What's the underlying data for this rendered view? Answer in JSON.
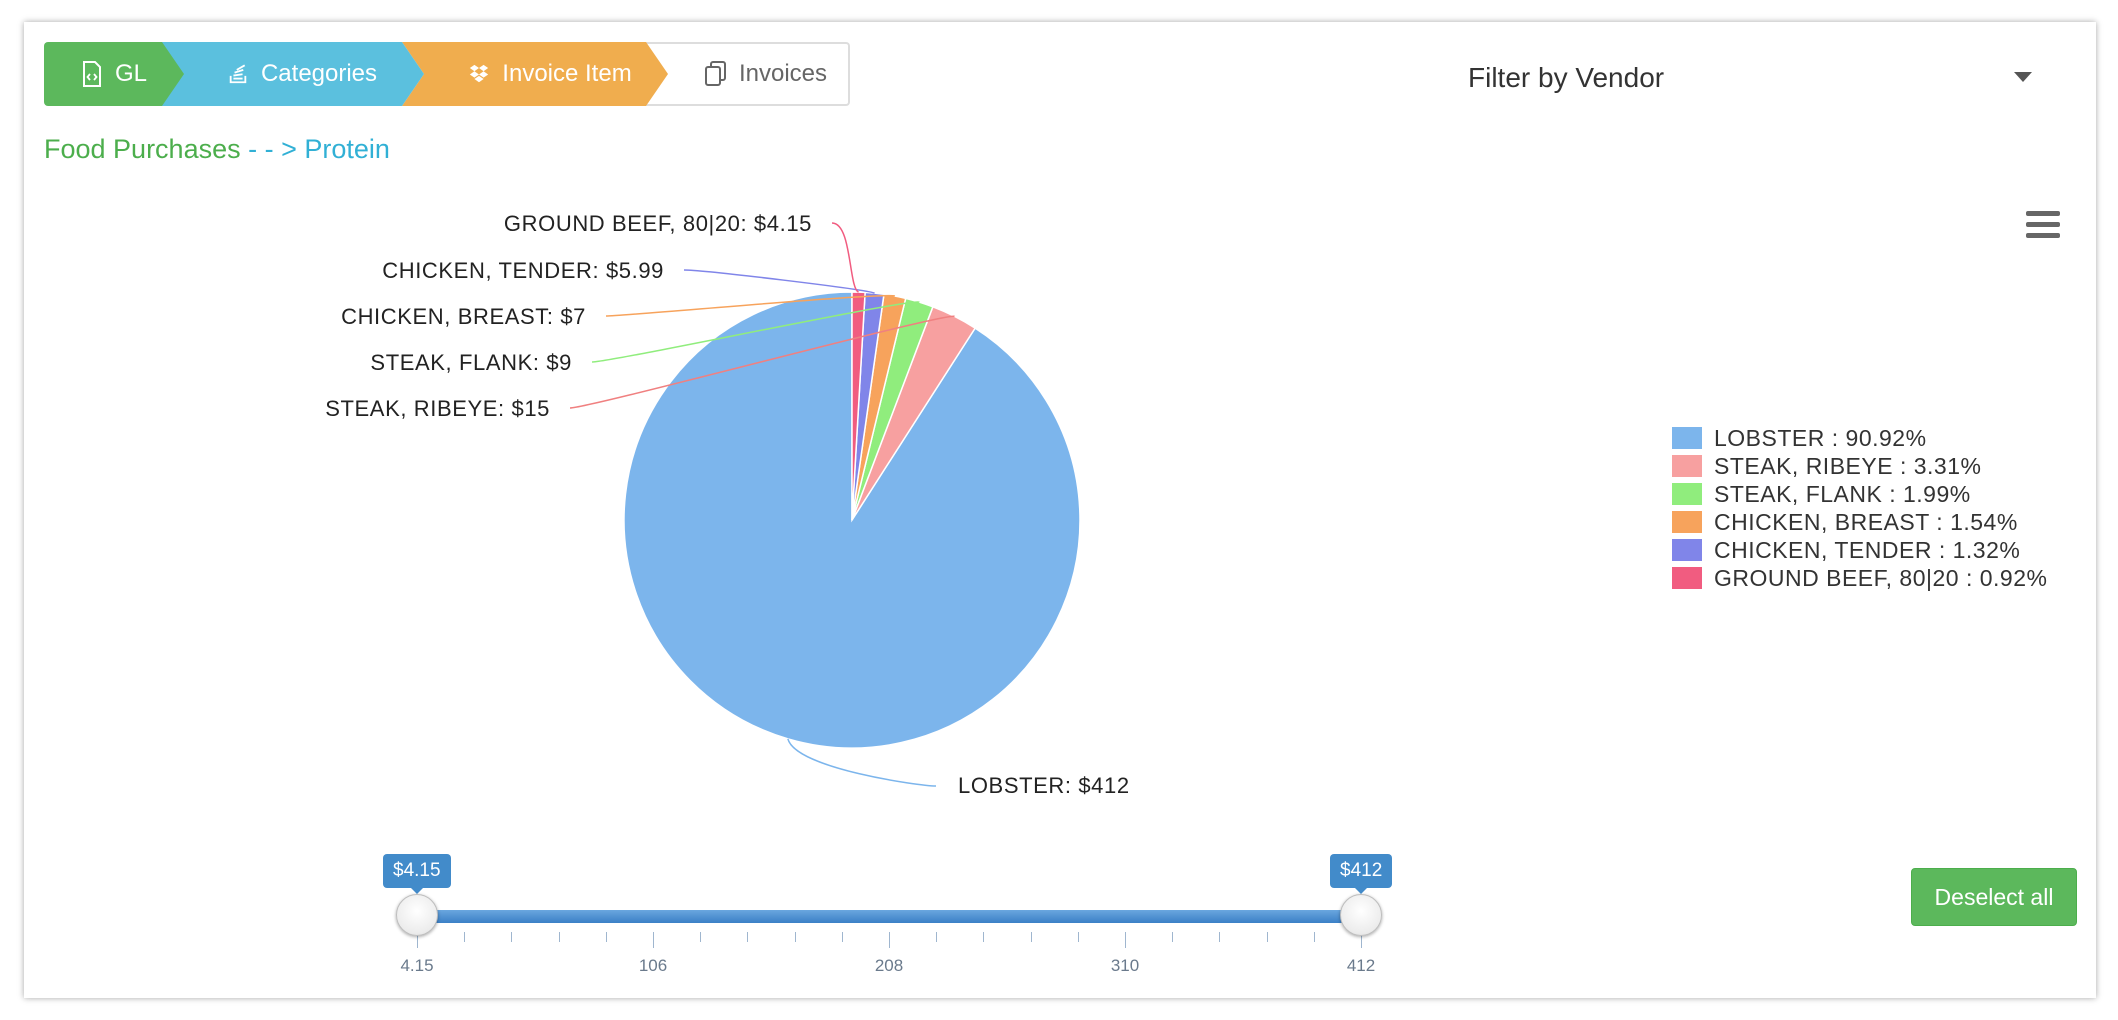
{
  "breadcrumbs": {
    "gl": "GL",
    "categories": "Categories",
    "invoice_item": "Invoice Item",
    "invoices": "Invoices"
  },
  "filter": {
    "label": "Filter by Vendor"
  },
  "path": {
    "parent": "Food Purchases",
    "separator": " - - > ",
    "current": "Protein"
  },
  "colors": {
    "green": "#5cb85c",
    "blue": "#5bc0de",
    "orange": "#f0ad4e",
    "slider": "#428bca"
  },
  "chart_data": {
    "type": "pie",
    "title": "",
    "currency": "$",
    "slices": [
      {
        "name": "LOBSTER",
        "value": 412,
        "label": "LOBSTER: $412",
        "percent_label": "LOBSTER : 90.92%",
        "color": "#7cb5ec"
      },
      {
        "name": "STEAK, RIBEYE",
        "value": 15,
        "label": "STEAK, RIBEYE: $15",
        "percent_label": "STEAK, RIBEYE : 3.31%",
        "color": "#f7a0a0"
      },
      {
        "name": "STEAK, FLANK",
        "value": 9,
        "label": "STEAK, FLANK: $9",
        "percent_label": "STEAK, FLANK : 1.99%",
        "color": "#90ed7d"
      },
      {
        "name": "CHICKEN, BREAST",
        "value": 7,
        "label": "CHICKEN, BREAST: $7",
        "percent_label": "CHICKEN, BREAST : 1.54%",
        "color": "#f7a35c"
      },
      {
        "name": "CHICKEN, TENDER",
        "value": 5.99,
        "label": "CHICKEN, TENDER: $5.99",
        "percent_label": "CHICKEN, TENDER : 1.32%",
        "color": "#8085e9"
      },
      {
        "name": "GROUND BEEF, 80|20",
        "value": 4.15,
        "label": "GROUND BEEF, 80|20: $4.15",
        "percent_label": "GROUND BEEF, 80|20 : 0.92%",
        "color": "#f15c80"
      }
    ],
    "legend_position": "right"
  },
  "slider": {
    "min": 4.15,
    "max": 412,
    "low": 4.15,
    "high": 412,
    "low_label": "$4.15",
    "high_label": "$412",
    "tick_labels": [
      "4.15",
      "106",
      "208",
      "310",
      "412"
    ]
  },
  "actions": {
    "deselect_all": "Deselect all"
  }
}
